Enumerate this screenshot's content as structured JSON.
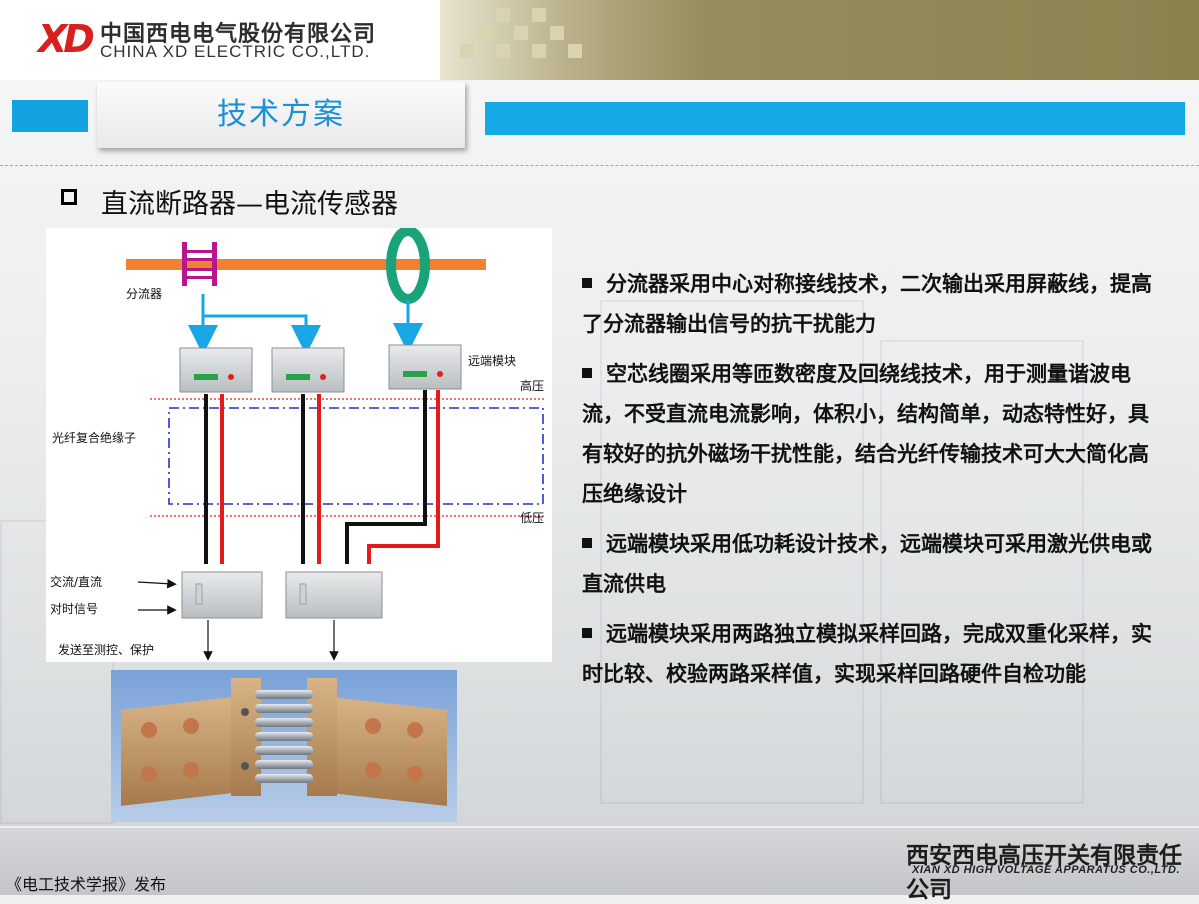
{
  "header": {
    "logo_mark": "XD",
    "company_cn": "中国西电电气股份有限公司",
    "company_en": "CHINA XD ELECTRIC CO.,LTD."
  },
  "page_title": "技术方案",
  "section_heading": "直流断路器—电流传感器",
  "diagram": {
    "shunt_label": "分流器",
    "remote_module_label": "远端模块",
    "high_voltage_label": "高压",
    "fiber_insulator_label": "光纤复合绝缘子",
    "low_voltage_label": "低压",
    "ac_dc_label": "交流/直流",
    "timing_label": "对时信号",
    "send_label": "发送至测控、保护",
    "colors": {
      "busbar": "#f08130",
      "coil": "#1aa37b",
      "arrow": "#19a6e6",
      "red_wire": "#e51b1b",
      "shunt": "#b8178c"
    }
  },
  "bullets": [
    "分流器采用中心对称接线技术，二次输出采用屏蔽线，提高了分流器输出信号的抗干扰能力",
    "空芯线圈采用等匝数密度及回绕线技术，用于测量谐波电流，不受直流电流影响，体积小，结构简单，动态特性好，具有较好的抗外磁场干扰性能，结合光纤传输技术可大大简化高压绝缘设计",
    "远端模块采用低功耗设计技术，远端模块可采用激光供电或直流供电",
    "远端模块采用两路独立模拟采样回路，完成双重化采样，实时比较、校验两路采样值，实现采样回路硬件自检功能"
  ],
  "footer": {
    "company_cn": "西安西电高压开关有限责任公司",
    "company_en": "XIAN XD HIGH VOLTAGE APPARATUS CO.,LTD.",
    "publisher": "《电工技术学报》发布"
  }
}
